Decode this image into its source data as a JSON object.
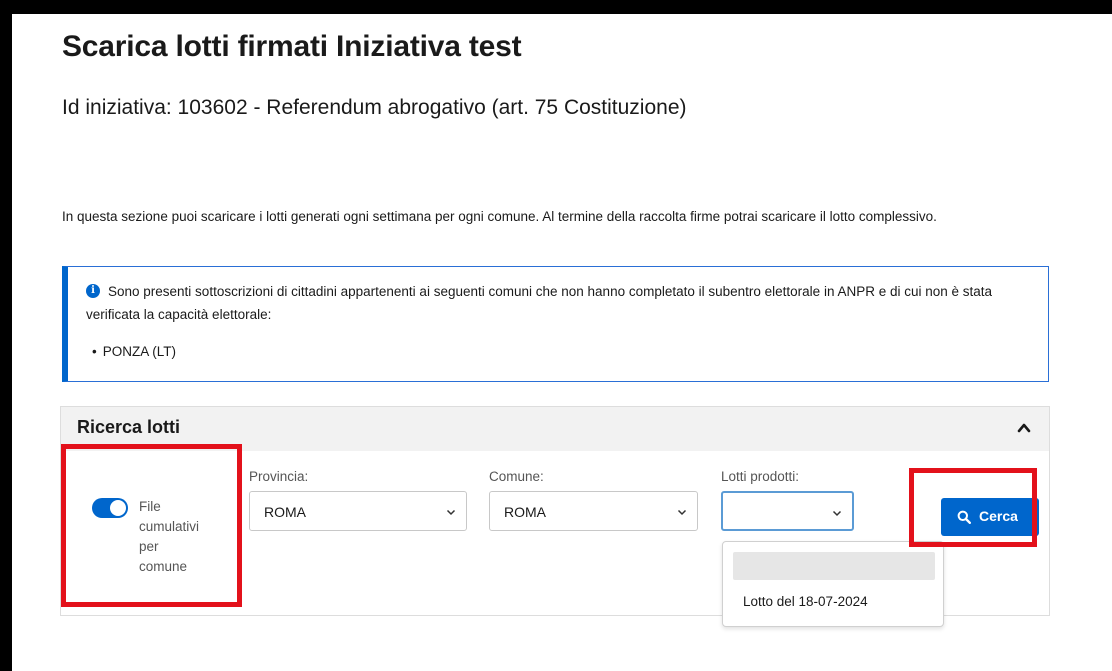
{
  "page": {
    "title": "Scarica lotti firmati Iniziativa test",
    "subtitle": "Id iniziativa: 103602 - Referendum abrogativo (art. 75 Costituzione)",
    "intro": "In questa sezione puoi scaricare i lotti generati ogni settimana per ogni comune. Al termine della raccolta firme potrai scaricare il lotto complessivo."
  },
  "alert": {
    "icon": "info-circle-icon",
    "text": "Sono presenti sottoscrizioni di cittadini appartenenti ai seguenti comuni che non hanno completato il subentro elettorale in ANPR e di cui non è stata verificata la capacità elettorale:",
    "items": [
      "PONZA (LT)"
    ]
  },
  "search_panel": {
    "title": "Ricerca lotti",
    "expanded": true,
    "toggle": {
      "label": "File cumulativi per comune",
      "checked": true
    },
    "provincia": {
      "label": "Provincia:",
      "value": "ROMA"
    },
    "comune": {
      "label": "Comune:",
      "value": "ROMA"
    },
    "lotti": {
      "label": "Lotti prodotti:",
      "value": "",
      "options": [
        "",
        "Lotto del 18-07-2024"
      ]
    },
    "search_button": "Cerca"
  },
  "colors": {
    "accent": "#0066cc",
    "highlight": "#e3111b"
  }
}
